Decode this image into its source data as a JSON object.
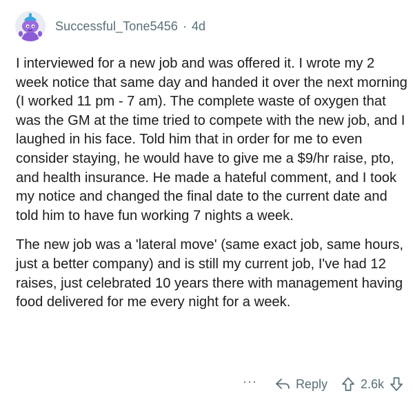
{
  "comment": {
    "author": "Successful_Tone5456",
    "separator": "·",
    "age": "4d",
    "paragraphs": [
      "I interviewed for a new job and was offered it. I wrote my 2 week notice that same day and handed it over the next morning (I worked 11 pm - 7 am). The complete waste of oxygen that was the GM at the time tried to compete with the new job, and I laughed in his face. Told him that in order for me to even consider staying, he would have to give me a $9/hr raise, pto, and health insurance. He made a hateful comment, and I took my notice and changed the final date to the current date and told him to have fun working 7 nights a week.",
      "The new job was a 'lateral move' (same exact job, same hours, just a better company) and is still my current job, I've had 12 raises, just celebrated 10 years there with management having food delivered for me every night for a week."
    ]
  },
  "actions": {
    "more": "···",
    "reply_label": "Reply",
    "score": "2.6k"
  },
  "icons": {
    "avatar": "snoo-avatar-icon",
    "more": "more-options-icon",
    "reply": "reply-arrow-icon",
    "upvote": "upvote-arrow-icon",
    "downvote": "downvote-arrow-icon"
  },
  "colors": {
    "meta_text": "#576f76",
    "body_text": "#1c1c1c",
    "avatar_bg": "#e9ecf2",
    "avatar_accent": "#8c5bd6"
  }
}
